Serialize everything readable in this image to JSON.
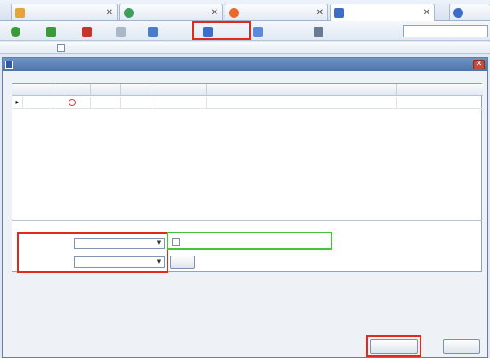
{
  "tabs": [
    {
      "label": "",
      "icon": "home-icon",
      "color": "#e8a23a"
    },
    {
      "label": "",
      "icon": "globe-icon",
      "color": "#3aa05a"
    },
    {
      "label": "",
      "icon": "store-icon",
      "color": "#e86a2a"
    },
    {
      "label": "",
      "icon": "upload-list-icon",
      "color": "#3a6ec8"
    },
    {
      "label": "",
      "icon": "all-icon",
      "color": "#3a6ec8"
    }
  ],
  "toolbar": {
    "update": "",
    "new": "",
    "delete": "",
    "upload": "",
    "batch_edit": "",
    "image_move": "",
    "custom_category": "",
    "sort": "",
    "search_label": ""
  },
  "grid_header": [
    "",
    "",
    "",
    "",
    "",
    "",
    "",
    "",
    ""
  ],
  "dialog": {
    "title": "",
    "columns": [
      "",
      "",
      "",
      "",
      "",
      "",
      ""
    ],
    "row": {
      "arrow": "▸",
      "num": "",
      "name": "",
      "action": "",
      "status": "",
      "title": "",
      "result": ""
    },
    "group_label": "",
    "storage_label": "",
    "storage_value": "",
    "category_label": "",
    "category_value": "",
    "open_button": "",
    "auto_check_label": "",
    "note": "",
    "start_button": "",
    "close_button": ""
  },
  "colors": {
    "red_highlight": "#e02a1c",
    "green_highlight": "#47c43a",
    "title_bar": "#4c73aa"
  }
}
